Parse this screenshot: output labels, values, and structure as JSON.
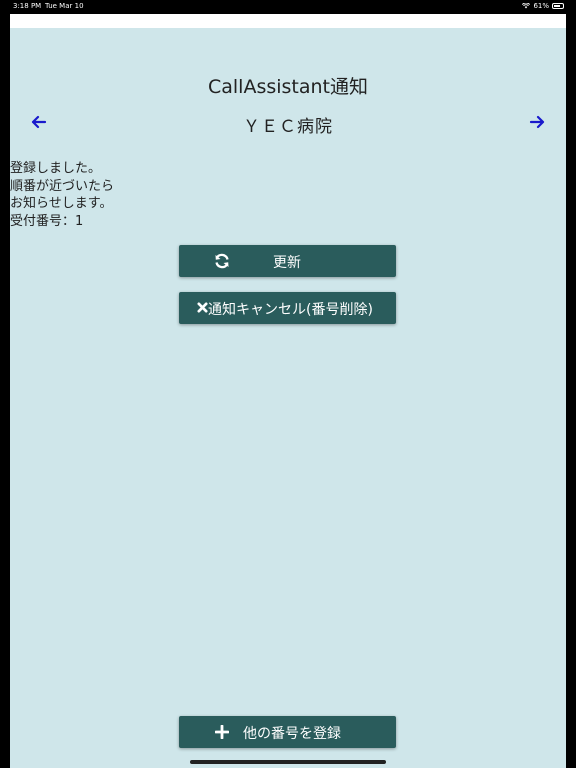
{
  "status_bar": {
    "time": "3:18 PM",
    "date": "Tue Mar 10",
    "battery": "61%"
  },
  "app": {
    "title": "CallAssistant通知"
  },
  "nav": {
    "clinic_name": "ＹＥＣ病院",
    "arrow_color": "#1a1acc"
  },
  "message": {
    "lines": [
      "登録しました。",
      "順番が近づいたら",
      "お知らせします。",
      "受付番号：1"
    ]
  },
  "buttons": {
    "refresh_label": "更新",
    "cancel_label": "通知キャンセル(番号削除)",
    "register_label": "他の番号を登録"
  },
  "colors": {
    "background": "#cfe6ea",
    "button": "#2a5c5c"
  }
}
